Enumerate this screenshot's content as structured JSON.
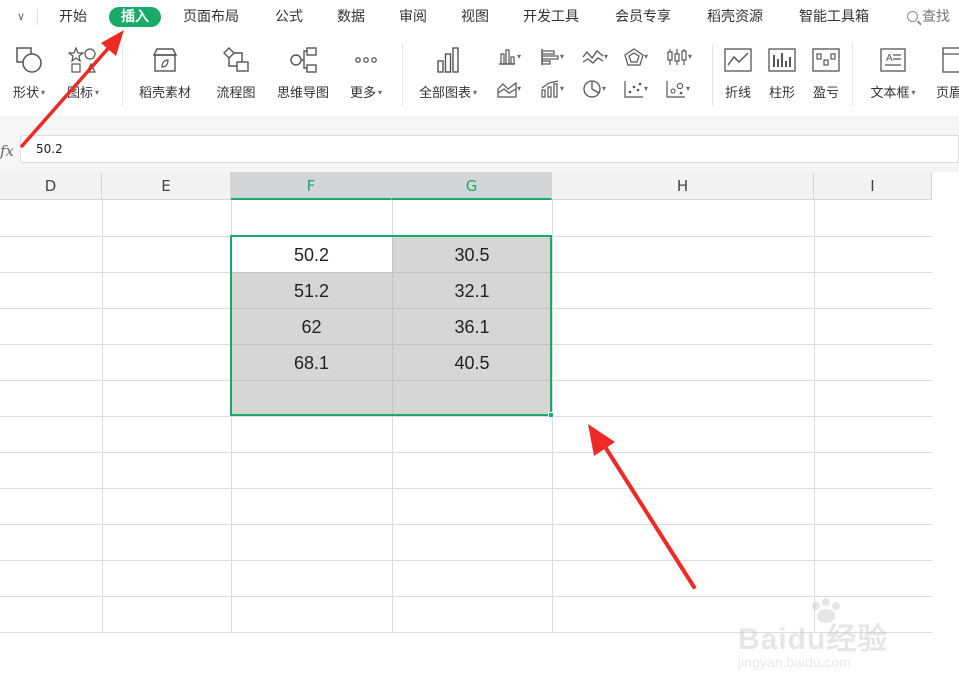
{
  "menubar": {
    "tabs": [
      "开始",
      "插入",
      "页面布局",
      "公式",
      "数据",
      "审阅",
      "视图",
      "开发工具",
      "会员专享",
      "稻壳资源",
      "智能工具箱"
    ],
    "active_tab": "插入",
    "search_label": "查找"
  },
  "ribbon": {
    "shape": "形状",
    "icon": "图标",
    "docer_material": "稻壳素材",
    "flowchart": "流程图",
    "mindmap": "思维导图",
    "more": "更多",
    "all_charts": "全部图表",
    "line": "折线",
    "column": "柱形",
    "win_loss": "盈亏",
    "textbox": "文本框",
    "header_footer": "页眉"
  },
  "formula_bar": {
    "fx": "fx",
    "value": "50.2"
  },
  "columns": [
    "D",
    "E",
    "F",
    "G",
    "H",
    "I"
  ],
  "selected_columns": [
    "F",
    "G"
  ],
  "cells": [
    [
      "50.2",
      "30.5"
    ],
    [
      "51.2",
      "32.1"
    ],
    [
      "62",
      "36.1"
    ],
    [
      "68.1",
      "40.5"
    ]
  ],
  "watermark": {
    "brand": "Baidu经验",
    "url": "jingyan.baidu.com"
  },
  "colors": {
    "accent_green": "#1aaa68",
    "annotation_red": "#ee2a24",
    "selection_gray": "#d6d6d6"
  }
}
